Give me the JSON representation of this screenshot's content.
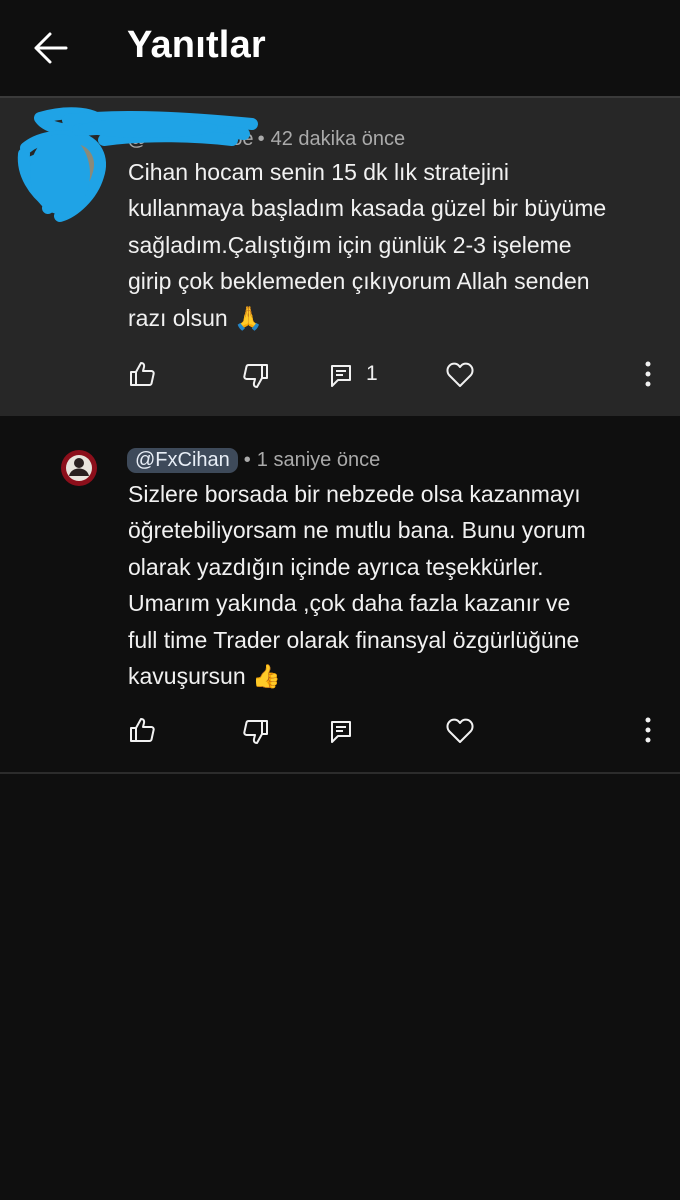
{
  "header": {
    "title": "Yanıtlar"
  },
  "parent_comment": {
    "handle_visible": "@",
    "handle_tail": "oe",
    "separator": "•",
    "time": "42 dakika önce",
    "lines": [
      "Cihan hocam senin 15 dk lık stratejini",
      "kullanmaya başladım  kasada güzel bir büyüme",
      "sağladım.Çalıştığım için günlük 2-3 işeleme",
      "girip çok beklemeden çıkıyorum Allah senden",
      "razı olsun 🙏"
    ],
    "reply_count": "1"
  },
  "reply_comment": {
    "handle": "@FxCihan",
    "separator": "•",
    "time": "1 saniye önce",
    "lines": [
      "Sizlere borsada bir nebzede olsa kazanmayı",
      "öğretebiliyorsam ne mutlu bana. Bunu yorum",
      "olarak yazdığın içinde ayrıca teşekkürler.",
      "Umarım yakında ,çok daha fazla kazanır ve",
      "full time Trader olarak finansyal özgürlüğüne",
      "kavuşursun 👍"
    ]
  },
  "colors": {
    "background": "#0f0f0f",
    "highlight_background": "#272727",
    "text": "#f1f1f1",
    "meta_text": "#aaaaaa",
    "handle_chip": "#3e4a5a",
    "redaction_scribble": "#1fa3e6"
  },
  "icons": [
    "back-arrow-icon",
    "like-icon",
    "dislike-icon",
    "reply-icon",
    "heart-icon",
    "more-vert-icon"
  ]
}
